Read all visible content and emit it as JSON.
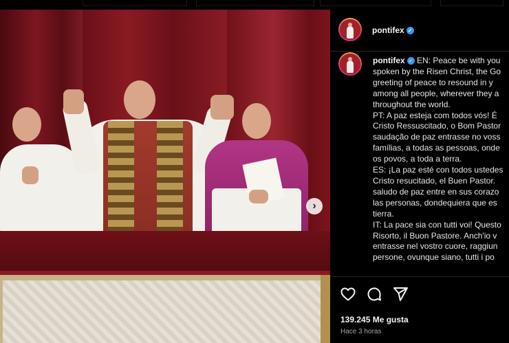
{
  "post": {
    "username": "pontifex",
    "verified_icon": "verified-badge-icon",
    "caption_lines": [
      "EN: Peace be with you",
      "spoken by the Risen Christ, the Go",
      "greeting of peace to resound in y",
      "among all people, wherever they a",
      "throughout the world.",
      "PT: A paz esteja com todos vós! É",
      "Cristo Ressuscitado, o Bom Pastor",
      "saudação de paz entrasse no voss",
      "famílias, a todas as pessoas, onde",
      "os povos, a toda a terra.",
      "ES: ¡La paz esté con todos ustedes",
      "Cristo resucitado, el Buen Pastor.",
      "saludo de paz entre en sus corazo",
      "las personas, dondequiera que es",
      "tierra.",
      "IT: La pace sia con tutti voi! Questo",
      "Risorto, il Buon Pastore. Anch'io v",
      "entrasse nel vostro cuore, raggiun",
      "persone, ovunque siano, tutti i po"
    ],
    "likes": "139.245 Me gusta",
    "time": "Hace 3 horas"
  },
  "media": {
    "next_icon": "chevron-right-icon",
    "next_label": "›"
  },
  "colors": {
    "background": "#000000",
    "verified": "#3897f0",
    "curtain": "#7d1620"
  }
}
